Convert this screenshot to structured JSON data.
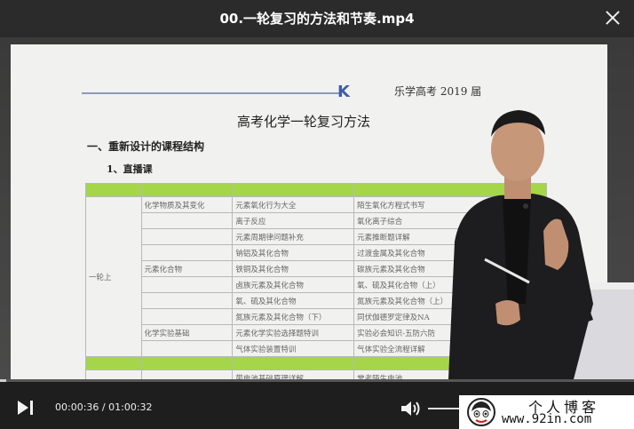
{
  "window": {
    "title": "00.一轮复习的方法和节奏.mp4"
  },
  "slide": {
    "logo": "K",
    "brand": "乐学高考 2019 届",
    "title": "高考化学一轮复习方法",
    "section1": "一、重新设计的课程结构",
    "section2": "1、直播课",
    "table": {
      "group_label": "一轮上",
      "rows": [
        {
          "cat": "化学物质及其变化",
          "col3": "元素氧化行为大全",
          "col4": "陌生氧化方程式书写"
        },
        {
          "cat": "",
          "col3": "离子反应",
          "col4": "氧化离子综合"
        },
        {
          "cat": "",
          "col3": "元素周期律问题补充",
          "col4": "元素推断题详解"
        },
        {
          "cat": "",
          "col3": "钠铝及其化合物",
          "col4": "过渡金属及其化合物"
        },
        {
          "cat": "元素化合物",
          "col3": "铁铜及其化合物",
          "col4": "碳族元素及其化合物"
        },
        {
          "cat": "",
          "col3": "卤族元素及其化合物",
          "col4": "氧、硫及其化合物（上）"
        },
        {
          "cat": "",
          "col3": "氧、硫及其化合物",
          "col4": "氮族元素及其化合物（上）"
        },
        {
          "cat": "",
          "col3": "氮族元素及其化合物（下）",
          "col4": "同伏伽德罗定律及NA"
        },
        {
          "cat": "化学实验基础",
          "col3": "元素化学实验选择题特训",
          "col4": "实验必会知识-五防六防"
        },
        {
          "cat": "",
          "col3": "气体实验装置特训",
          "col4": "气体实验全流程详解"
        }
      ],
      "bottom_row": {
        "col3": "带电池基础原理详解",
        "col4": "常考陌生电池"
      }
    }
  },
  "player": {
    "current_time": "00:00:36",
    "separator": "/",
    "duration": "01:00:32",
    "progress": 0.0099,
    "volume": 0.85
  },
  "watermark": {
    "name": "个人博客",
    "url": "www.92in.com"
  },
  "colors": {
    "table_green": "#a5d64a",
    "logo_blue": "#3b5fa8"
  }
}
